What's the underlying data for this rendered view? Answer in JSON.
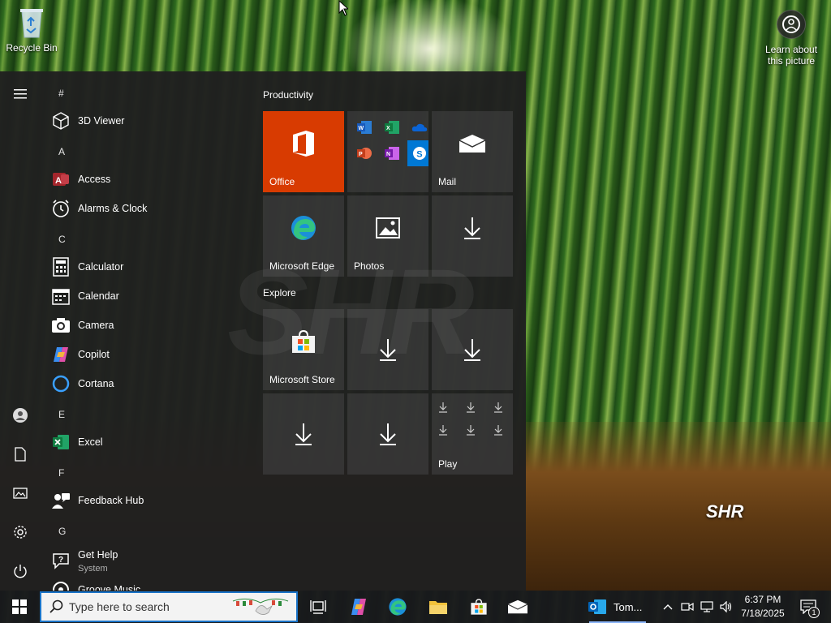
{
  "desktop": {
    "recycle_bin_label": "Recycle Bin",
    "learn_label_line1": "Learn about",
    "learn_label_line2": "this picture",
    "logo_text": "SHR"
  },
  "start_menu": {
    "letters": [
      "#",
      "A",
      "C",
      "E",
      "F",
      "G"
    ],
    "apps": [
      {
        "label": "3D Viewer",
        "icon": "cube-icon"
      },
      {
        "label": "Access",
        "icon": "access-icon"
      },
      {
        "label": "Alarms & Clock",
        "icon": "clock-icon"
      },
      {
        "label": "Calculator",
        "icon": "calculator-icon"
      },
      {
        "label": "Calendar",
        "icon": "calendar-icon"
      },
      {
        "label": "Camera",
        "icon": "camera-icon"
      },
      {
        "label": "Copilot",
        "icon": "copilot-icon"
      },
      {
        "label": "Cortana",
        "icon": "cortana-icon"
      },
      {
        "label": "Excel",
        "icon": "excel-icon"
      },
      {
        "label": "Feedback Hub",
        "icon": "feedback-icon"
      },
      {
        "label": "Get Help",
        "sublabel": "System",
        "icon": "help-icon"
      },
      {
        "label": "Groove Music",
        "icon": "music-icon"
      }
    ],
    "groups": {
      "productivity": "Productivity",
      "explore": "Explore"
    },
    "tiles": {
      "office": "Office",
      "mail": "Mail",
      "edge": "Microsoft Edge",
      "photos": "Photos",
      "store": "Microsoft Store",
      "play": "Play"
    }
  },
  "taskbar": {
    "search_placeholder": "Type here to search",
    "outlook_label": "Tom...",
    "time": "6:37 PM",
    "date": "7/18/2025",
    "notification_count": "1"
  },
  "colors": {
    "office_tile": "#d83b01",
    "accent": "#1a73c7"
  }
}
